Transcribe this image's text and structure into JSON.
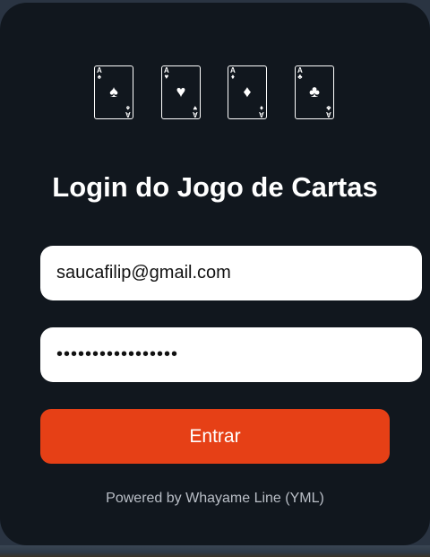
{
  "cards": [
    {
      "rank": "A",
      "suit": "♠"
    },
    {
      "rank": "A",
      "suit": "♥"
    },
    {
      "rank": "A",
      "suit": "♦"
    },
    {
      "rank": "A",
      "suit": "♣"
    }
  ],
  "title": "Login do Jogo de Cartas",
  "email": {
    "value": "saucafilip@gmail.com"
  },
  "password": {
    "value": "•••••••••••••••••"
  },
  "login_button": {
    "label": "Entrar"
  },
  "footer": {
    "text": "Powered by Whayame Line (YML)"
  },
  "colors": {
    "panel": "#11171e",
    "accent": "#e64016",
    "text": "#ffffff"
  }
}
